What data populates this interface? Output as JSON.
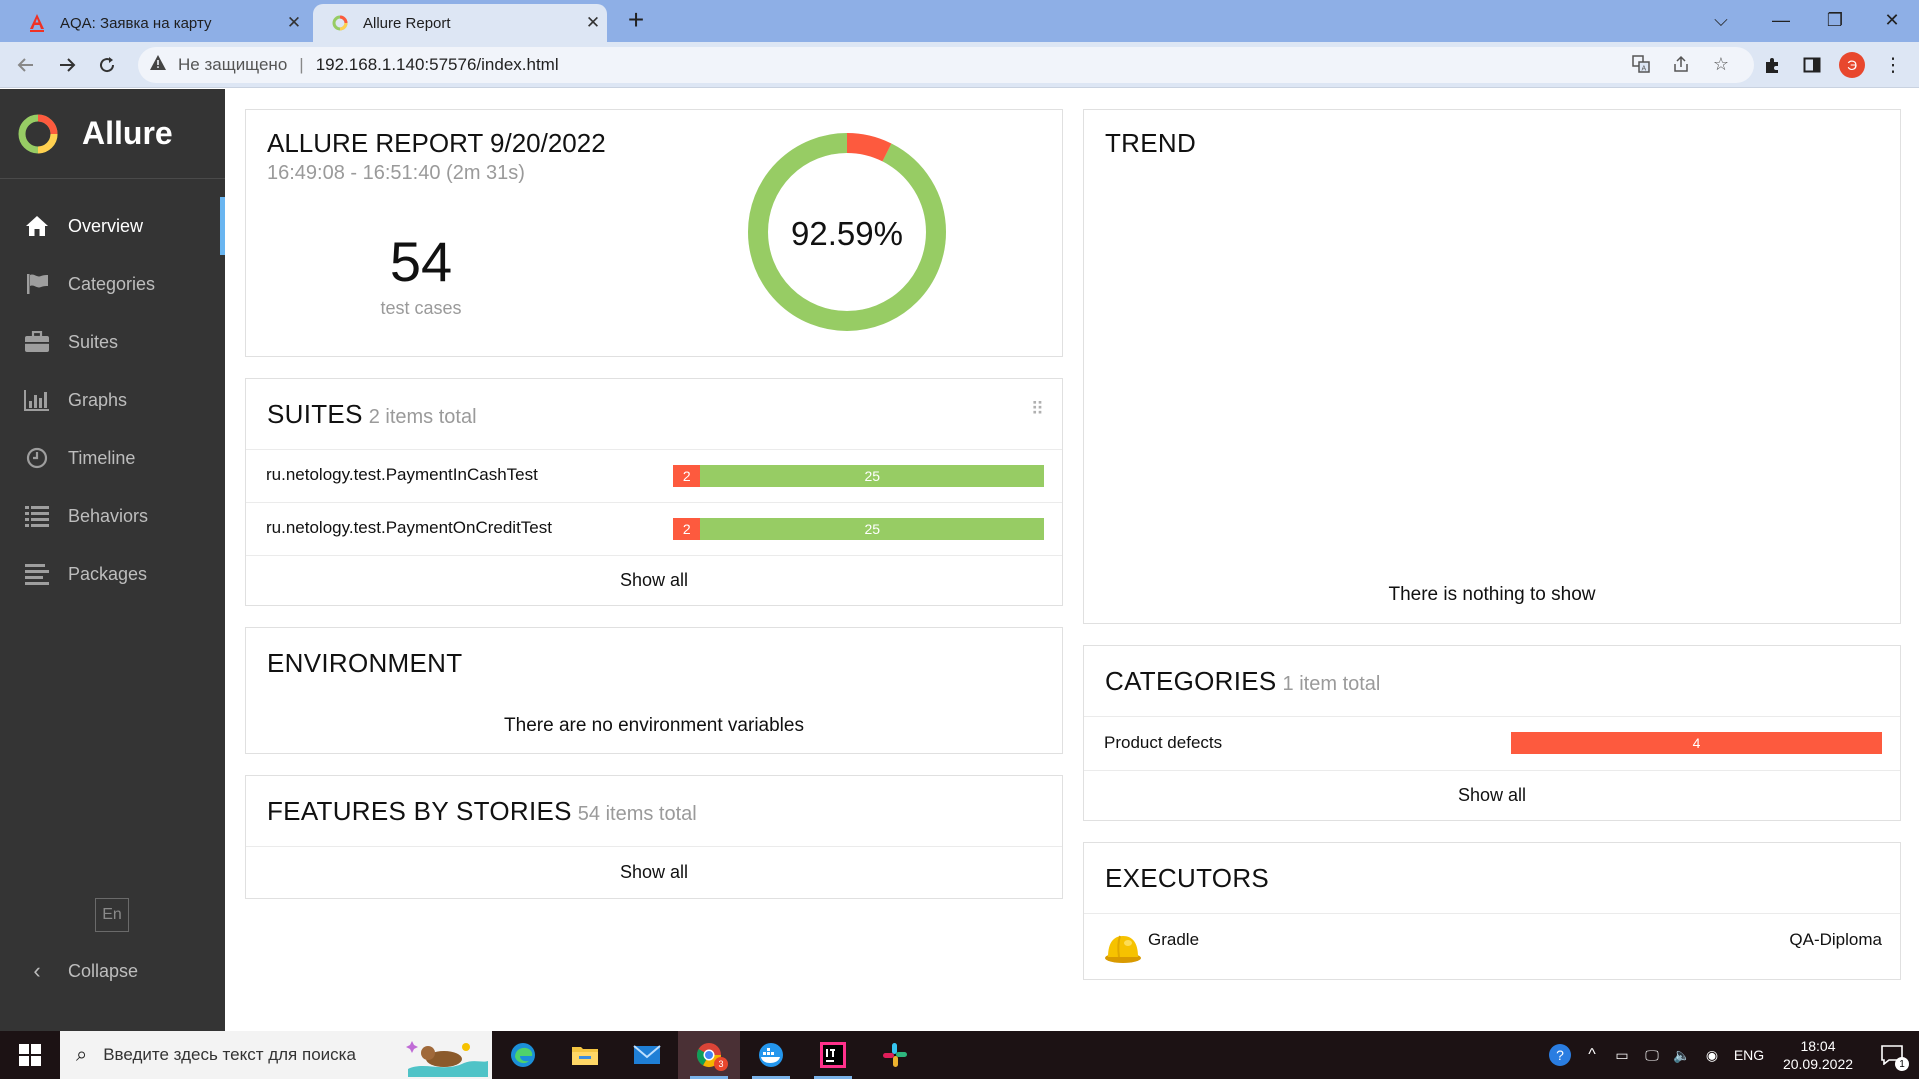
{
  "browser": {
    "tabs": [
      {
        "title": "AQA: Заявка на карту",
        "active": false
      },
      {
        "title": "Allure Report",
        "active": true
      }
    ],
    "security_label": "Не защищено",
    "url": "192.168.1.140:57576/index.html",
    "profile_initial": "Э"
  },
  "sidebar": {
    "brand": "Allure",
    "items": [
      {
        "label": "Overview",
        "icon": "home-icon",
        "active": true
      },
      {
        "label": "Categories",
        "icon": "flag-icon"
      },
      {
        "label": "Suites",
        "icon": "briefcase-icon"
      },
      {
        "label": "Graphs",
        "icon": "bar-chart-icon"
      },
      {
        "label": "Timeline",
        "icon": "clock-icon"
      },
      {
        "label": "Behaviors",
        "icon": "list-icon"
      },
      {
        "label": "Packages",
        "icon": "align-left-icon"
      }
    ],
    "language": "En",
    "collapse_label": "Collapse"
  },
  "summary": {
    "title": "ALLURE REPORT 9/20/2022",
    "time_range": "16:49:08 - 16:51:40 (2m 31s)",
    "test_count": "54",
    "test_count_label": "test cases",
    "success_rate": "92.59%",
    "passed_fraction": 0.9259,
    "failed_fraction": 0.0741
  },
  "suites": {
    "title": "SUITES",
    "subtitle": "2 items total",
    "rows": [
      {
        "name": "ru.netology.test.PaymentInCashTest",
        "failed": "2",
        "passed": "25",
        "failed_n": 2,
        "passed_n": 25
      },
      {
        "name": "ru.netology.test.PaymentOnCreditTest",
        "failed": "2",
        "passed": "25",
        "failed_n": 2,
        "passed_n": 25
      }
    ],
    "show_all": "Show all"
  },
  "environment": {
    "title": "ENVIRONMENT",
    "empty_text": "There are no environment variables"
  },
  "features": {
    "title": "FEATURES BY STORIES",
    "subtitle": "54 items total",
    "show_all": "Show all"
  },
  "trend": {
    "title": "TREND",
    "empty_text": "There is nothing to show"
  },
  "categories": {
    "title": "CATEGORIES",
    "subtitle": "1 item total",
    "rows": [
      {
        "name": "Product defects",
        "count": "4"
      }
    ],
    "show_all": "Show all"
  },
  "executors": {
    "title": "EXECUTORS",
    "rows": [
      {
        "name": "Gradle",
        "build": "QA-Diploma"
      }
    ]
  },
  "taskbar": {
    "search_placeholder": "Введите здесь текст для поиска",
    "language": "ENG",
    "time": "18:04",
    "date": "20.09.2022",
    "chrome_badge": "3",
    "notification_count": "1"
  },
  "colors": {
    "failed": "#fd5a3e",
    "passed": "#97cc64",
    "sidebar_bg": "#343434",
    "accent": "#69b5f0"
  }
}
